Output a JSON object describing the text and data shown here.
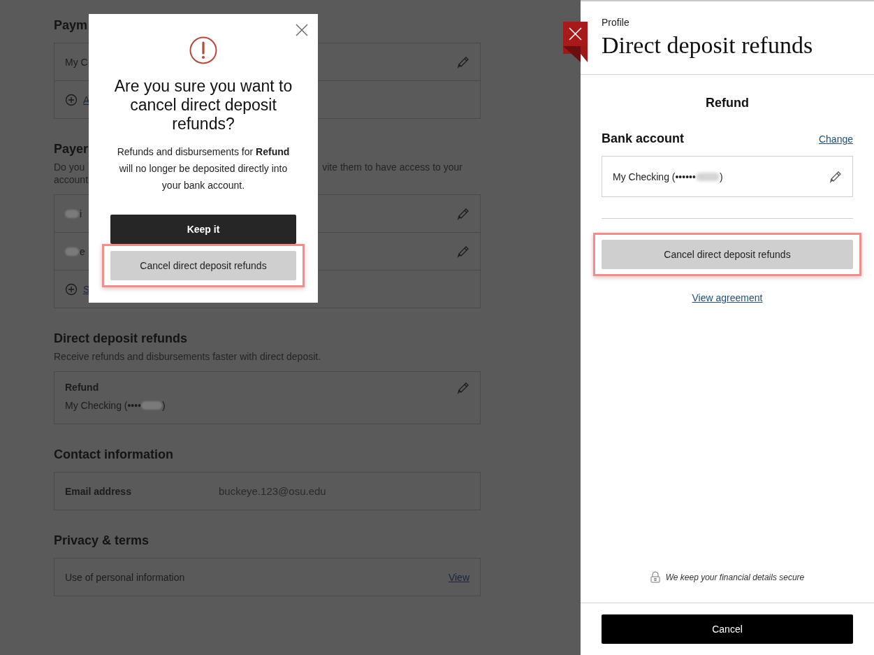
{
  "page": {
    "sections": [
      {
        "heading": "Paym",
        "rows": [
          {
            "kind": "item",
            "text": "My C",
            "edit_icon": true
          },
          {
            "kind": "add",
            "link": "A"
          }
        ]
      },
      {
        "heading": "Payer",
        "description_lines": [
          {
            "left": "Do you",
            "right": "vite them to have access to your"
          },
          {
            "left": "account"
          }
        ],
        "rows": [
          {
            "kind": "blurred",
            "text": "i",
            "edit_icon": true
          },
          {
            "kind": "blurred",
            "text": "e",
            "edit_icon": true
          },
          {
            "kind": "add",
            "link": "S"
          }
        ]
      },
      {
        "heading": "Direct deposit refunds",
        "description_lines": [
          {
            "left": "Receive refunds and disbursements faster with direct deposit."
          }
        ],
        "rows": [
          {
            "kind": "detail",
            "title": "Refund",
            "prefix": "My Checking (••••",
            "suffix": ")",
            "edit_icon": true
          }
        ]
      },
      {
        "heading": "Contact information",
        "rows": [
          {
            "kind": "field",
            "label": "Email address",
            "value": "buckeye.123@osu.edu"
          }
        ]
      },
      {
        "heading": "Privacy & terms",
        "rows": [
          {
            "kind": "link-row",
            "text": "Use of personal information",
            "link": "View"
          }
        ]
      }
    ]
  },
  "modal": {
    "title": "Are you sure you want to cancel direct deposit refunds?",
    "message": "Refunds and disbursements for **Refund** will no longer be deposited directly into your bank account.",
    "buttons": [
      {
        "label": "Keep it",
        "kind": "primary",
        "highlighted": false
      },
      {
        "label": "Cancel direct deposit refunds",
        "kind": "secondary",
        "highlighted": true
      }
    ]
  },
  "panel": {
    "breadcrumb": "Profile",
    "title": "Direct deposit refunds",
    "subtitle": "Refund",
    "bank_label": "Bank account",
    "change_link": "Change",
    "account": {
      "prefix": "My Checking (••••••",
      "suffix": ")",
      "edit_icon": true
    },
    "action": {
      "label": "Cancel direct deposit refunds",
      "highlighted": true
    },
    "agreement_link": "View agreement",
    "security_note": "We keep your financial details secure",
    "footer_button": "Cancel"
  }
}
